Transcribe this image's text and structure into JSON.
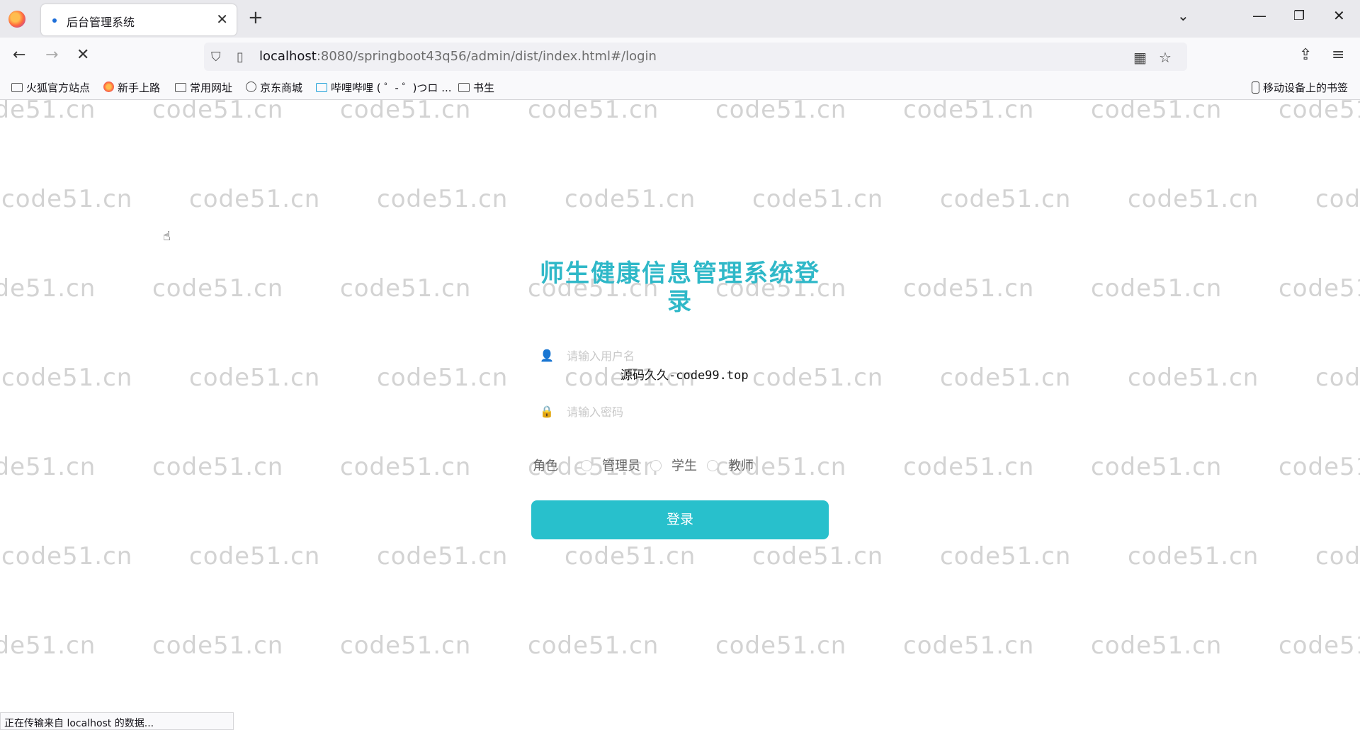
{
  "browser": {
    "tab_title": "后台管理系统",
    "url_host": "localhost",
    "url_rest": ":8080/springboot43q56/admin/dist/index.html#/login",
    "bookmarks": [
      "火狐官方站点",
      "新手上路",
      "常用网址",
      "京东商城",
      "哔哩哔哩 ( ゜- ゜)つロ ...",
      "书生"
    ],
    "mobile_bookmarks": "移动设备上的书签",
    "status": "正在传输来自 localhost 的数据..."
  },
  "watermark": "code51.cn",
  "login": {
    "title": "师生健康信息管理系统登录",
    "username_placeholder": "请输入用户名",
    "password_placeholder": "请输入密码",
    "overlay_text": "源码久久-code99.top",
    "role_label": "角色",
    "roles": [
      "管理员",
      "学生",
      "教师"
    ],
    "submit_label": "登录"
  },
  "colors": {
    "accent": "#28c0cc",
    "title": "#2fb8c8"
  }
}
